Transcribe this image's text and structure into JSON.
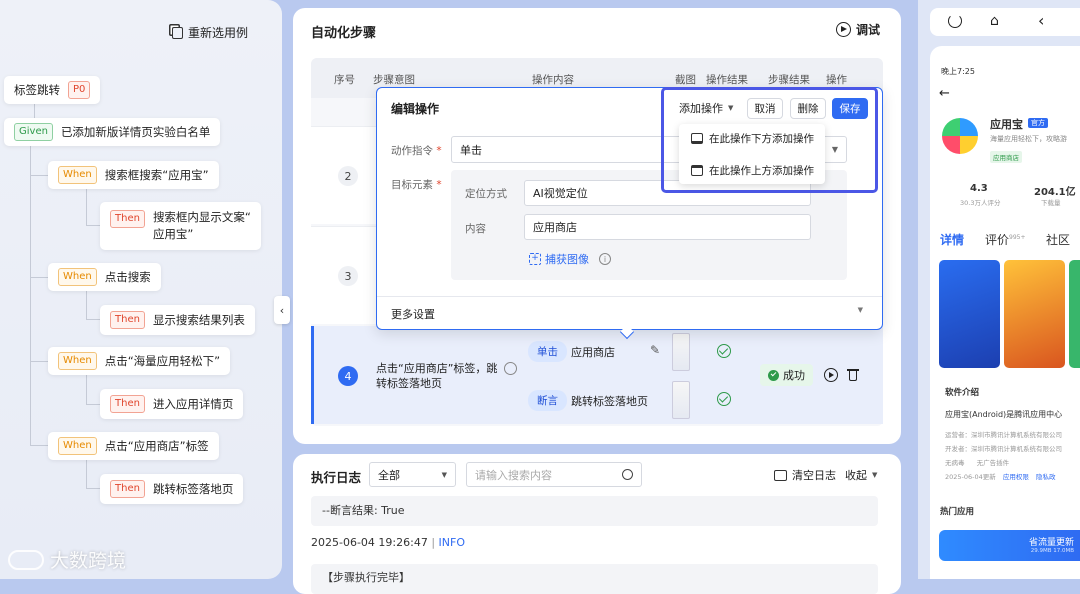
{
  "tree": {
    "reselect_label": "重新选用例",
    "root": {
      "label": "标签跳转",
      "tag": "P0"
    },
    "given": {
      "tag": "Given",
      "label": "已添加新版详情页实验白名单"
    },
    "steps": [
      {
        "tag": "When",
        "label": "搜索框搜索“应用宝”"
      },
      {
        "tag": "Then",
        "label_line1": "搜索框内显示文案“",
        "label_line2": "应用宝”"
      },
      {
        "tag": "When",
        "label": "点击搜索"
      },
      {
        "tag": "Then",
        "label": "显示搜索结果列表"
      },
      {
        "tag": "When",
        "label": "点击“海量应用轻松下”"
      },
      {
        "tag": "Then",
        "label": "进入应用详情页"
      },
      {
        "tag": "When",
        "label": "点击“应用商店”标签"
      },
      {
        "tag": "Then",
        "label": "跳转标签落地页"
      }
    ]
  },
  "automation": {
    "title": "自动化步骤",
    "debug_label": "调试",
    "columns": [
      "序号",
      "步骤意图",
      "操作内容",
      "截图",
      "操作结果",
      "步骤结果",
      "操作"
    ],
    "row_numbers": [
      "2",
      "3"
    ],
    "editor": {
      "title": "编辑操作",
      "add_op_label": "添加操作",
      "cancel_label": "取消",
      "delete_label": "删除",
      "save_label": "保存",
      "menu": [
        "在此操作下方添加操作",
        "在此操作上方添加操作"
      ],
      "action_label": "动作指令",
      "action_value": "单击",
      "target_label": "目标元素",
      "locate_label": "定位方式",
      "locate_value": "AI视觉定位",
      "content_label": "内容",
      "content_value": "应用商店",
      "capture_label": "捕获图像",
      "more_settings": "更多设置"
    },
    "row4": {
      "number": "4",
      "intent_line1": "点击“应用商店”标签，跳",
      "intent_line2": "转标签落地页",
      "ops": [
        {
          "action": "单击",
          "content": "应用商店"
        },
        {
          "action": "断言",
          "content": "跳转标签落地页"
        }
      ],
      "status": "成功"
    }
  },
  "log": {
    "title": "执行日志",
    "filter_value": "全部",
    "search_placeholder": "请输入搜索内容",
    "clear_label": "清空日志",
    "collapse_label": "收起",
    "lines": [
      "--断言结果: True",
      "2025-06-04 19:26:47",
      "INFO",
      "【步骤执行完毕】"
    ]
  },
  "phone": {
    "status_time": "晚上7:25",
    "app_name": "应用宝",
    "official_badge": "官方",
    "subtitle": "海量应用轻松下，攻略游",
    "category": "应用商店",
    "rating": "4.3",
    "rating_sub": "30.3万人评分",
    "downloads": "204.1亿",
    "downloads_sub": "下载量",
    "tabs": [
      "详情",
      "评价",
      "社区"
    ],
    "review_count": "995+",
    "intro_title": "软件介绍",
    "intro_text": "应用宝(Android)是腾讯应用中心",
    "operator": "运营者：深圳市腾讯计算机系统有限公司",
    "developer": "开发者：深圳市腾讯计算机系统有限公司",
    "flags": [
      "无病毒",
      "无广告插件"
    ],
    "date_line": "2025-06-04更新",
    "links": [
      "应用权限",
      "隐私政"
    ],
    "hot_title": "热门应用",
    "update_btn": "省流量更新",
    "update_sub": "29.9MB 17.0MB"
  },
  "watermark": "大数跨境"
}
